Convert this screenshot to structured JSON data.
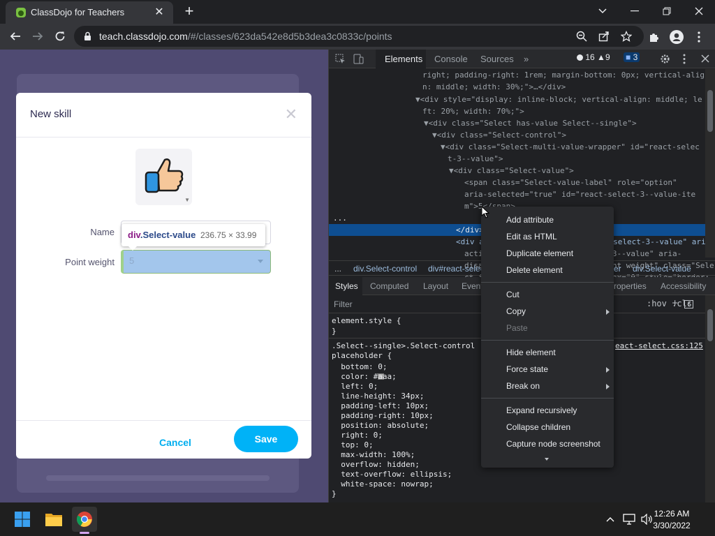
{
  "browser": {
    "tab_title": "ClassDojo for Teachers",
    "url_host": "teach.classdojo.com",
    "url_path": "/#/classes/623da542e8d5b3dea3c0833c/points"
  },
  "modal": {
    "title": "New skill",
    "name_label": "Name",
    "point_weight_label": "Point weight",
    "point_weight_value": "5",
    "cancel_label": "Cancel",
    "save_label": "Save",
    "icon": "thumbs-up-icon"
  },
  "tooltip": {
    "tag": "div",
    "class_name": ".Select-value",
    "dimensions": "236.75 × 33.99"
  },
  "devtools": {
    "tabs": [
      "Elements",
      "Console",
      "Sources"
    ],
    "more_tabs": "»",
    "errors": "16",
    "warnings": "9",
    "messages": "3",
    "dom_lines": [
      "right; padding-right: 1rem; margin-bottom: 0px; vertical-alig",
      "n: middle; width: 30%;\">…</div>",
      "▼<div style=\"display: inline-block; vertical-align: middle; le",
      "ft: 20%; width: 70%;\">",
      "▼<div class=\"Select has-value Select--single\">",
      "▼<div class=\"Select-control\">",
      "▼<div class=\"Select-multi-value-wrapper\" id=\"react-selec",
      "t-3--value\">",
      "▼<div class=\"Select-value\">",
      "<span class=\"Select-value-label\" role=\"option\"",
      "aria-selected=\"true\" id=\"react-select-3--value-ite",
      "m\">5</span>",
      "</div>",
      "<div aria-activedescendant=\"react-select-3--value\" aria-",
      "active-descendant=\"react-select-3--value\" aria-",
      "disabled=\"false\" aria-label=\"Point weight\" class=\"Sele",
      "ct-input\" role=\"combobox\" tabindex=\"0\" style=\"border:"
    ],
    "selected_marker": "...",
    "breadcrumbs": [
      "...",
      "div.Select-control",
      "div#react-selec",
      "er",
      "div.Select-value"
    ],
    "styles_tabs": [
      "Styles",
      "Computed",
      "Layout",
      "Event",
      "roperties",
      "Accessibility"
    ],
    "filter_placeholder": "Filter",
    "filter_tools": ":hov .cls",
    "css_lines": [
      "element.style {",
      "}",
      ".Select--single>.Select-control .",
      "placeholder {",
      "  bottom: 0;",
      "  color: #aaa;",
      "  left: 0;",
      "  line-height: 34px;",
      "  padding-left: 10px;",
      "  padding-right: 10px;",
      "  position: absolute;",
      "  right: 0;",
      "  top: 0;",
      "  max-width: 100%;",
      "  overflow: hidden;",
      "  text-overflow: ellipsis;",
      "  white-space: nowrap;",
      "}"
    ],
    "css_source": "eact-select.css:125"
  },
  "context_menu": {
    "items": [
      {
        "label": "Add attribute",
        "disabled": false,
        "submenu": false
      },
      {
        "label": "Edit as HTML",
        "disabled": false,
        "submenu": false
      },
      {
        "label": "Duplicate element",
        "disabled": false,
        "submenu": false
      },
      {
        "label": "Delete element",
        "disabled": false,
        "submenu": false
      },
      {
        "label": "Cut",
        "disabled": false,
        "submenu": false
      },
      {
        "label": "Copy",
        "disabled": false,
        "submenu": true
      },
      {
        "label": "Paste",
        "disabled": true,
        "submenu": false
      },
      {
        "label": "Hide element",
        "disabled": false,
        "submenu": false
      },
      {
        "label": "Force state",
        "disabled": false,
        "submenu": true
      },
      {
        "label": "Break on",
        "disabled": false,
        "submenu": true
      },
      {
        "label": "Expand recursively",
        "disabled": false,
        "submenu": false
      },
      {
        "label": "Collapse children",
        "disabled": false,
        "submenu": false
      },
      {
        "label": "Capture node screenshot",
        "disabled": false,
        "submenu": false
      }
    ]
  },
  "taskbar": {
    "time": "12:26 AM",
    "date": "3/30/2022"
  },
  "colors": {
    "accent": "#00b2f7",
    "devtools_selection": "#0e4e91",
    "page_overlay": "#4f4a72"
  }
}
